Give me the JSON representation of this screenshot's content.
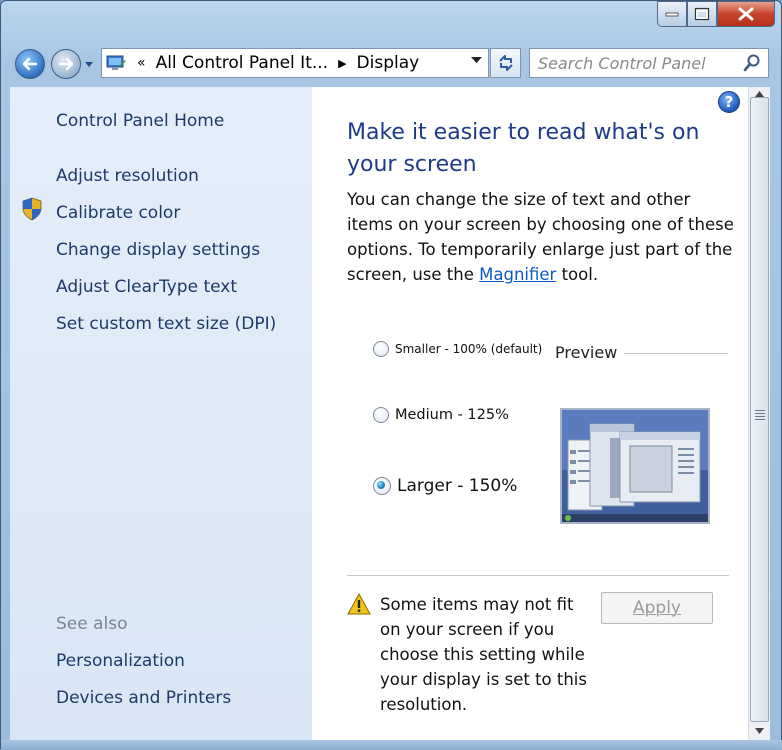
{
  "window": {
    "caption_buttons": [
      "minimize-icon",
      "maximize-icon",
      "close-icon"
    ]
  },
  "address_bar": {
    "chevron": "«",
    "segments": [
      "All Control Panel It...",
      "Display"
    ],
    "separator": "▶"
  },
  "search": {
    "placeholder": "Search Control Panel"
  },
  "sidebar": {
    "home": "Control Panel Home",
    "items": [
      "Adjust resolution",
      "Calibrate color",
      "Change display settings",
      "Adjust ClearType text",
      "Set custom text size (DPI)"
    ],
    "see_also_label": "See also",
    "see_also": [
      "Personalization",
      "Devices and Printers"
    ]
  },
  "main": {
    "title": "Make it easier to read what's on your screen",
    "para_before": "You can change the size of text and other items on your screen by choosing one of these options. To temporarily enlarge just part of the screen, use the ",
    "para_link": "Magnifier",
    "para_after": " tool.",
    "options": [
      {
        "label": "Smaller - 100% (default)",
        "selected": false
      },
      {
        "label": "Medium - 125%",
        "selected": false
      },
      {
        "label": "Larger - 150%",
        "selected": true
      }
    ],
    "preview_label": "Preview",
    "warning": "Some items may not fit on your screen if you choose this setting while your display is set to this resolution.",
    "apply_label": "Apply",
    "help": "?"
  },
  "colors": {
    "link": "#1e3a6a",
    "title": "#1e3a8a",
    "sidebar_bg": "#dfe9f6"
  }
}
